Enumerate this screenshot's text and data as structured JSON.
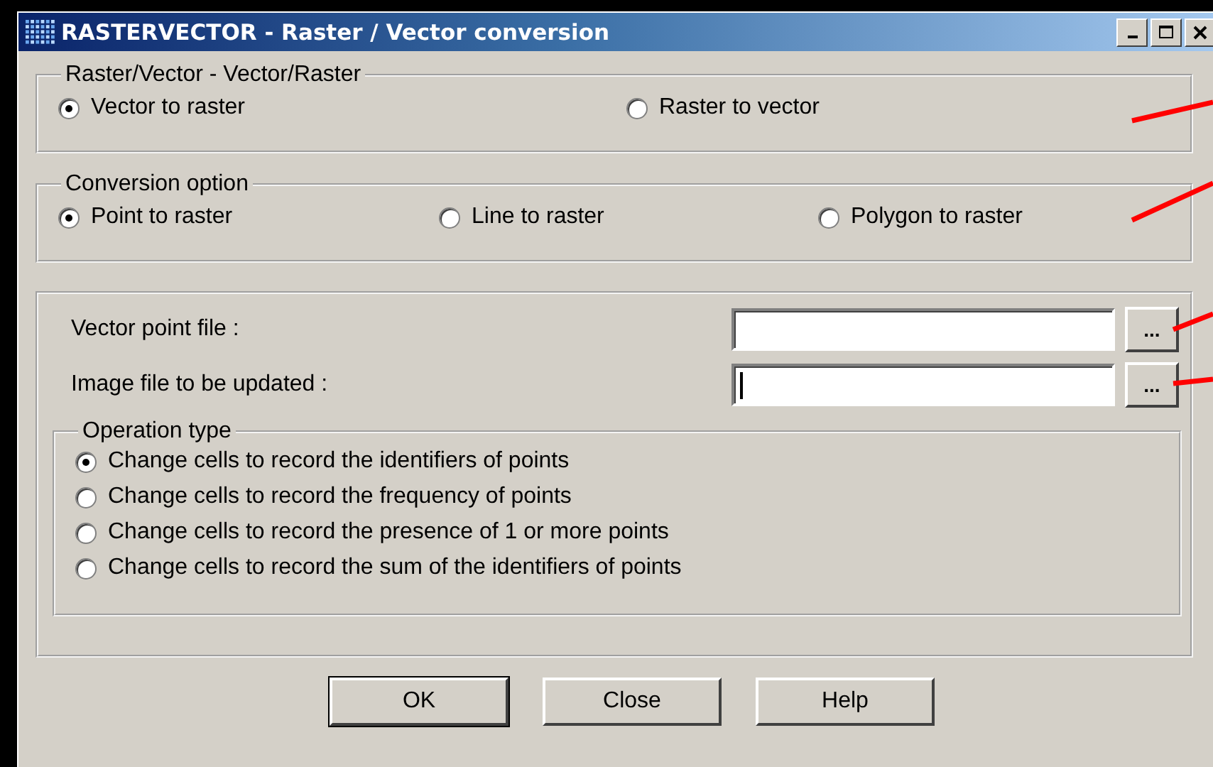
{
  "window": {
    "title": "RASTERVECTOR - Raster / Vector conversion"
  },
  "direction_group": {
    "title": "Raster/Vector - Vector/Raster",
    "options": [
      {
        "label": "Vector to raster",
        "selected": true
      },
      {
        "label": "Raster to vector",
        "selected": false
      }
    ]
  },
  "conversion_group": {
    "title": "Conversion option",
    "options": [
      {
        "label": "Point to raster",
        "selected": true
      },
      {
        "label": "Line to raster",
        "selected": false
      },
      {
        "label": "Polygon to raster",
        "selected": false
      }
    ]
  },
  "files": [
    {
      "label": "Vector point file :",
      "browse": "...",
      "focused": false
    },
    {
      "label": "Image file to be updated :",
      "browse": "...",
      "focused": true
    }
  ],
  "operation_group": {
    "title": "Operation type",
    "options": [
      {
        "label": "Change cells to record the identifiers of points",
        "selected": true
      },
      {
        "label": "Change cells to record the frequency of points",
        "selected": false
      },
      {
        "label": "Change cells to record the presence of 1 or more points",
        "selected": false
      },
      {
        "label": "Change cells to record the sum of the identifiers of points",
        "selected": false
      }
    ]
  },
  "buttons": [
    {
      "label": "OK",
      "default": true
    },
    {
      "label": "Close",
      "default": false
    },
    {
      "label": "Help",
      "default": false
    }
  ]
}
